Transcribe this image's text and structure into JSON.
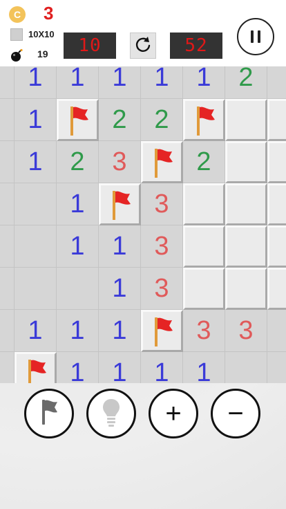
{
  "hud": {
    "coin_symbol": "C",
    "coins": "3",
    "board_size": "10X10",
    "mines": "19",
    "flags_display": "10",
    "time_display": "52"
  },
  "icons": {
    "coin": "coin-icon",
    "board_size": "square-icon",
    "mines": "bomb-icon",
    "restart": "restart-icon",
    "pause": "pause-icon",
    "flag": "flag-icon",
    "hint": "lightbulb-icon"
  },
  "colors": {
    "n1": "#3a3ad8",
    "n2": "#2f9a4a",
    "n3": "#e05a5a",
    "lcd_text": "#e01818",
    "coin_count": "#e02020"
  },
  "board": {
    "rows": [
      [
        "",
        "1",
        "1",
        "1",
        "1",
        "1",
        "2",
        ""
      ],
      [
        "",
        "1",
        "F",
        "2",
        "2",
        "F",
        "#",
        "#"
      ],
      [
        "",
        "1",
        "2",
        "3",
        "F",
        "2",
        "#",
        "#"
      ],
      [
        "",
        "",
        "1",
        "F",
        "3",
        "#",
        "#",
        "#"
      ],
      [
        "",
        "",
        "1",
        "1",
        "3",
        "#",
        "#",
        "#"
      ],
      [
        "",
        "",
        "",
        "1",
        "3",
        "#",
        "#",
        "#"
      ],
      [
        "",
        "1",
        "1",
        "1",
        "F",
        "3",
        "3",
        ""
      ],
      [
        "",
        "F",
        "1",
        "1",
        "1",
        "1",
        "",
        ""
      ]
    ]
  },
  "controls": {
    "zoom_in_label": "+",
    "zoom_out_label": "−"
  }
}
